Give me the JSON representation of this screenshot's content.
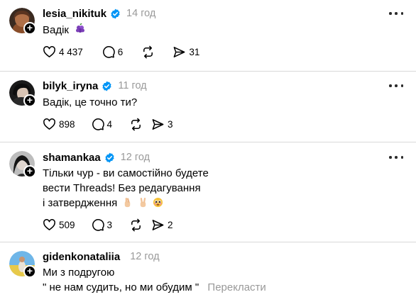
{
  "posts": [
    {
      "username": "lesia_nikituk",
      "verified": true,
      "time": "14 год",
      "lines": [
        "Вадік"
      ],
      "emoji": "purple-grapes",
      "likes": "4 437",
      "comments": "6",
      "shares": "31"
    },
    {
      "username": "bilyk_iryna",
      "verified": true,
      "time": "11 год",
      "lines": [
        "Вадік, це точно ти?"
      ],
      "likes": "898",
      "comments": "4",
      "shares": "3"
    },
    {
      "username": "shamankaa",
      "verified": true,
      "time": "12 год",
      "lines": [
        "Тільки чур - ви самостійно будете",
        "вести Threads! Без редагування",
        "і затвердження"
      ],
      "emoji": [
        "crossed-fingers",
        "victory-hand",
        "pleading-face"
      ],
      "likes": "509",
      "comments": "3",
      "shares": "2"
    },
    {
      "username": "gidenkonataliia",
      "verified": false,
      "time": "12 год",
      "lines": [
        "Ми з подругою",
        "\" не нам судить, но ми обудим \""
      ],
      "translate": "Перекласти"
    }
  ],
  "icons": {
    "like": "heart-icon",
    "comment": "comment-icon",
    "repost": "repost-icon",
    "share": "send-icon",
    "more": "more-icon",
    "follow": "plus-icon",
    "verified": "verified-badge-icon"
  },
  "colors": {
    "text": "#000000",
    "muted": "#999999",
    "verified": "#0095f6",
    "divider": "#d9d9d9"
  }
}
